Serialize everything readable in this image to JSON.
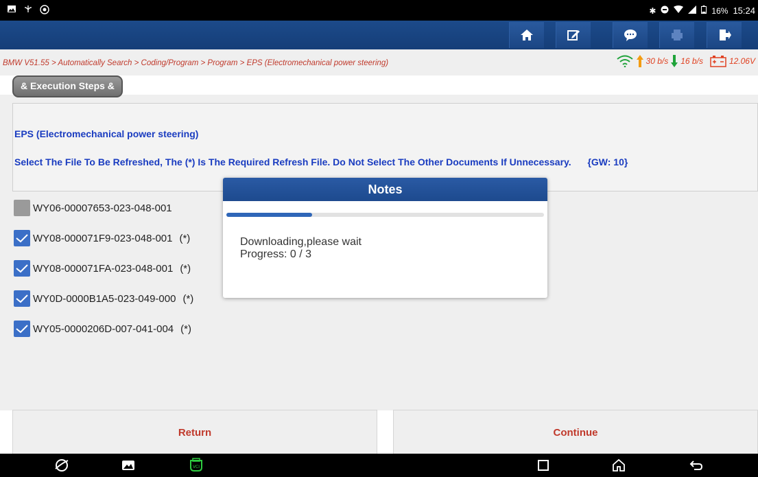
{
  "statusbar": {
    "battery": "16%",
    "time": "15:24"
  },
  "toolbar": {
    "icons": [
      "home-icon",
      "edit-icon",
      "chat-icon",
      "print-icon",
      "exit-icon"
    ]
  },
  "breadcrumb": "BMW V51.55 > Automatically Search > Coding/Program > Program > EPS (Electromechanical power steering)",
  "network": {
    "up": "30 b/s",
    "down": "16 b/s",
    "voltage": "12.06V"
  },
  "steps_tab": "& Execution Steps &",
  "message": {
    "title": "EPS (Electromechanical power steering)",
    "description": "Select The File To Be Refreshed, The (*) Is The Required Refresh File. Do Not Select The Other Documents If Unnecessary.",
    "gw": "{GW: 10}"
  },
  "files": [
    {
      "name": "WY06-00007653-023-048-001",
      "suffix": "",
      "checked": false
    },
    {
      "name": "WY08-000071F9-023-048-001",
      "suffix": "(*)",
      "checked": true
    },
    {
      "name": "WY08-000071FA-023-048-001",
      "suffix": "(*)",
      "checked": true
    },
    {
      "name": "WY0D-0000B1A5-023-049-000",
      "suffix": "(*)",
      "checked": true
    },
    {
      "name": "WY05-0000206D-007-041-004",
      "suffix": "(*)",
      "checked": true
    }
  ],
  "buttons": {
    "return": "Return",
    "continue": "Continue"
  },
  "dialog": {
    "title": "Notes",
    "line1": "Downloading,please wait",
    "line2": "Progress: 0 / 3",
    "progress_fraction": 0.27
  },
  "colors": {
    "accent_blue": "#1d4a8e",
    "link_red": "#c0392b",
    "text_blue": "#1a3cc0"
  }
}
